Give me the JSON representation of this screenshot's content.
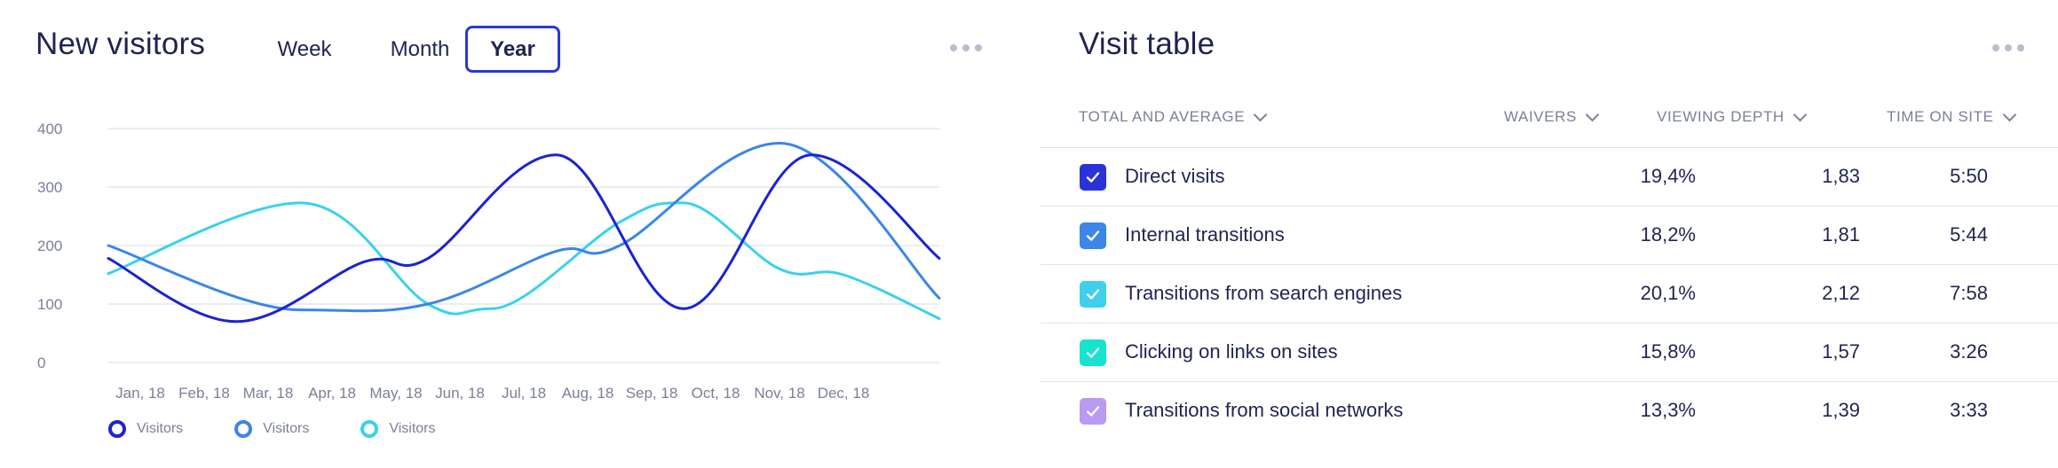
{
  "left_panel": {
    "title": "New visitors",
    "tabs": [
      {
        "label": "Week",
        "active": false
      },
      {
        "label": "Month",
        "active": false
      },
      {
        "label": "Year",
        "active": true
      }
    ],
    "more_icon": "more-horizontal-icon",
    "legend": [
      {
        "label": "Visitors",
        "color": "#1b23d1"
      },
      {
        "label": "Visitors",
        "color": "#3b86e6"
      },
      {
        "label": "Visitors",
        "color": "#3ad1ef"
      }
    ]
  },
  "chart_data": {
    "type": "line",
    "title": "",
    "xlabel": "",
    "ylabel": "",
    "categories": [
      "Jan, 18",
      "Feb, 18",
      "Mar, 18",
      "Apr, 18",
      "May, 18",
      "Jun, 18",
      "Jul, 18",
      "Aug, 18",
      "Sep, 18",
      "Oct, 18",
      "Nov, 18",
      "Dec, 18"
    ],
    "x_positions": [
      0.5,
      1.5,
      2.5,
      3.5,
      4.5,
      5.5,
      6.5,
      7.5,
      8.5,
      9.5,
      10.5,
      11.5
    ],
    "ylim": [
      0,
      400
    ],
    "yticks": [
      0,
      100,
      200,
      300,
      400
    ],
    "grid": true,
    "legend_position": "bottom-left",
    "series": [
      {
        "name": "Visitors",
        "color": "#1b23d1",
        "points": [
          [
            0,
            178
          ],
          [
            2,
            70
          ],
          [
            4,
            172
          ],
          [
            5,
            178
          ],
          [
            7,
            355
          ],
          [
            9,
            92
          ],
          [
            11,
            355
          ],
          [
            13,
            178
          ]
        ]
      },
      {
        "name": "Visitors",
        "color": "#3b86e6",
        "points": [
          [
            0,
            200
          ],
          [
            3,
            90
          ],
          [
            5,
            100
          ],
          [
            7,
            190
          ],
          [
            8,
            200
          ],
          [
            10.5,
            375
          ],
          [
            13,
            110
          ]
        ]
      },
      {
        "name": "Visitors",
        "color": "#3ad1ef",
        "points": [
          [
            0,
            152
          ],
          [
            3,
            273
          ],
          [
            5,
            100
          ],
          [
            6,
            92
          ],
          [
            8,
            240
          ],
          [
            9,
            273
          ],
          [
            10.5,
            160
          ],
          [
            11.5,
            150
          ],
          [
            13,
            75
          ]
        ]
      }
    ]
  },
  "right_panel": {
    "title": "Visit table",
    "more_icon": "more-horizontal-icon",
    "columns": [
      "TOTAL AND AVERAGE",
      "WAIVERS",
      "VIEWING DEPTH",
      "TIME ON SITE"
    ],
    "rows": [
      {
        "name": "Direct visits",
        "waivers": "19,4%",
        "depth": "1,83",
        "time": "5:50",
        "color": "#2a33d8",
        "checked": true
      },
      {
        "name": "Internal transitions",
        "waivers": "18,2%",
        "depth": "1,81",
        "time": "5:44",
        "color": "#3b86e6",
        "checked": true
      },
      {
        "name": "Transitions from search engines",
        "waivers": "20,1%",
        "depth": "2,12",
        "time": "7:58",
        "color": "#3fd0ef",
        "checked": true
      },
      {
        "name": "Clicking on links on sites",
        "waivers": "15,8%",
        "depth": "1,57",
        "time": "3:26",
        "color": "#17e3cf",
        "checked": true
      },
      {
        "name": "Transitions from social networks",
        "waivers": "13,3%",
        "depth": "1,39",
        "time": "3:33",
        "color": "#b89af0",
        "checked": true
      }
    ]
  }
}
